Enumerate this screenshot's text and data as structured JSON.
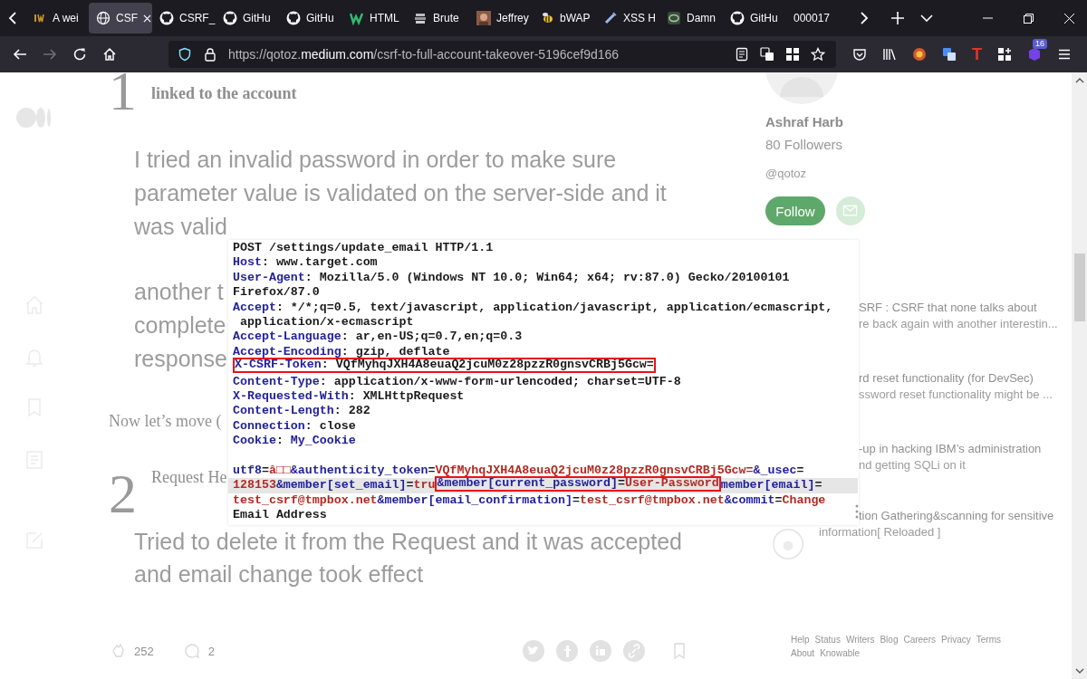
{
  "tabs": [
    {
      "label": "A wei",
      "kind": "letters",
      "selected": false
    },
    {
      "label": "CSF",
      "kind": "globe",
      "selected": true
    },
    {
      "label": "CSRF_",
      "kind": "github",
      "selected": false
    },
    {
      "label": "GitHu",
      "kind": "github",
      "selected": false
    },
    {
      "label": "GitHu",
      "kind": "github",
      "selected": false
    },
    {
      "label": "HTML",
      "kind": "w",
      "selected": false
    },
    {
      "label": "Brute",
      "kind": "stack",
      "selected": false
    },
    {
      "label": "Jeffrey",
      "selected": false
    },
    {
      "label": "bWAP",
      "kind": "bee",
      "selected": false
    },
    {
      "label": "XSS H",
      "kind": "pen",
      "selected": false
    },
    {
      "label": "Damn",
      "kind": "ring",
      "selected": false
    },
    {
      "label": "GitHu",
      "kind": "github",
      "selected": false
    },
    {
      "label": "000017",
      "kind": "plain",
      "selected": false
    }
  ],
  "navigation": {
    "forward_disabled": true
  },
  "address_bar": {
    "scheme": "https://qotoz.",
    "domain": "medium.com",
    "path": "/csrf-to-full-account-takeover-5196cef9d166"
  },
  "extensions": {
    "letter": "T",
    "badge": "16"
  },
  "article": {
    "step_one": {
      "number": "1",
      "heading": "linked to the account"
    },
    "paragraph_one": [
      "I tried an invalid password in order to make sure",
      "parameter value is validated on the server-side and it",
      "was valid"
    ],
    "paragraph_two": [
      "another t",
      "complete",
      "response"
    ],
    "transition": "Now let’s move (",
    "step_two": {
      "number": "2",
      "heading": "Request He"
    },
    "paragraph_three": [
      "Tried to delete it from the Request and it was accepted",
      "and email change took effect"
    ]
  },
  "engagement": {
    "claps": "252",
    "responses": "2"
  },
  "author": {
    "name": "Ashraf Harb",
    "followers": "80 Followers",
    "handle": "@qotoz",
    "follow": "Follow"
  },
  "related": [
    {
      "title": "SRF : CSRF that none talks about",
      "subtitle": "re back again with another interestin...",
      "kind": "plain"
    },
    {
      "title": "rd reset functionality (for DevSec)",
      "subtitle": "ssword reset functionality might be ...",
      "kind": "plain"
    },
    {
      "title": "-up in hacking IBM’s administration",
      "subtitle": "nd getting SQLi on it",
      "kind": "plain"
    },
    {
      "title": "tion Gathering&scanning for sensitive",
      "subtitle": "information[ Reloaded ]",
      "kind": "badge"
    }
  ],
  "footer": [
    "Help",
    "Status",
    "Writers",
    "Blog",
    "Careers",
    "Privacy",
    "Terms",
    "About",
    "Knowable"
  ],
  "code_image": {
    "lines": [
      {
        "kind": "text",
        "highlighted": false,
        "shaded": false,
        "segments": [
          {
            "kind": "text",
            "text": "POST /settings/update_email HTTP/1.1"
          }
        ]
      },
      {
        "kind": "text",
        "highlighted": false,
        "shaded": false,
        "segments": [
          {
            "kind": "name",
            "text": "Host"
          },
          {
            "kind": "text",
            "text": ": www.target.com"
          }
        ]
      },
      {
        "kind": "text",
        "highlighted": false,
        "shaded": false,
        "segments": [
          {
            "kind": "name",
            "text": "User-Agent"
          },
          {
            "kind": "text",
            "text": ": Mozilla/5.0 (Windows NT 10.0; Win64; x64; rv:87.0) Gecko/20100101"
          }
        ]
      },
      {
        "kind": "text",
        "highlighted": false,
        "shaded": false,
        "segments": [
          {
            "kind": "text",
            "text": "Firefox/87.0"
          }
        ]
      },
      {
        "kind": "text",
        "highlighted": false,
        "shaded": false,
        "segments": [
          {
            "kind": "name",
            "text": "Accept"
          },
          {
            "kind": "text",
            "text": ": */*;q=0.5, text/javascript, application/javascript, application/ecmascript,"
          }
        ]
      },
      {
        "kind": "text",
        "highlighted": false,
        "shaded": false,
        "segments": [
          {
            "kind": "text",
            "text": " application/x-ecmascript"
          }
        ]
      },
      {
        "kind": "text",
        "highlighted": false,
        "shaded": false,
        "segments": [
          {
            "kind": "name",
            "text": "Accept-Language"
          },
          {
            "kind": "text",
            "text": ": ar,en-US;q=0.7,en;q=0.3"
          }
        ]
      },
      {
        "kind": "text",
        "highlighted": false,
        "shaded": false,
        "segments": [
          {
            "kind": "name",
            "text": "Accept-Encoding"
          },
          {
            "kind": "text",
            "text": ": gzip, deflate"
          }
        ]
      },
      {
        "kind": "text",
        "highlighted": true,
        "shaded": false,
        "segments": [
          {
            "kind": "name",
            "text": "X-CSRF-Token"
          },
          {
            "kind": "text",
            "text": ": VQfMyhqJXH4A8euaQ2jcuM0z28pzzR0gnsvCRBj5Gcw="
          }
        ]
      },
      {
        "kind": "text",
        "highlighted": false,
        "shaded": false,
        "segments": [
          {
            "kind": "name",
            "text": "Content-Type"
          },
          {
            "kind": "text",
            "text": ": application/x-www-form-urlencoded; charset=UTF-8"
          }
        ]
      },
      {
        "kind": "text",
        "highlighted": false,
        "shaded": false,
        "segments": [
          {
            "kind": "name",
            "text": "X-Requested-With"
          },
          {
            "kind": "text",
            "text": ": XMLHttpRequest"
          }
        ]
      },
      {
        "kind": "text",
        "highlighted": false,
        "shaded": false,
        "segments": [
          {
            "kind": "name",
            "text": "Content-Length"
          },
          {
            "kind": "text",
            "text": ": 282"
          }
        ]
      },
      {
        "kind": "text",
        "highlighted": false,
        "shaded": false,
        "segments": [
          {
            "kind": "name",
            "text": "Connection"
          },
          {
            "kind": "text",
            "text": ": close"
          }
        ]
      },
      {
        "kind": "text",
        "highlighted": false,
        "shaded": false,
        "segments": [
          {
            "kind": "name",
            "text": "Cookie"
          },
          {
            "kind": "text",
            "text": ": "
          },
          {
            "kind": "name",
            "text": "My_Cookie"
          }
        ]
      },
      {
        "kind": "blank"
      },
      {
        "kind": "text",
        "highlighted": false,
        "shaded": false,
        "segments": [
          {
            "kind": "name",
            "text": "utf8"
          },
          {
            "kind": "text",
            "text": "="
          },
          {
            "kind": "value",
            "text": "â□□"
          },
          {
            "kind": "name",
            "text": "&authenticity_token"
          },
          {
            "kind": "text",
            "text": "="
          },
          {
            "kind": "value",
            "text": "VQfMyhqJXH4A8euaQ2jcuM0z28pzzR0gnsvCRBj5Gcw="
          },
          {
            "kind": "name",
            "text": "&_usec"
          },
          {
            "kind": "text",
            "text": "="
          }
        ]
      },
      {
        "kind": "text",
        "highlighted": false,
        "shaded": true,
        "segments": [
          {
            "kind": "value",
            "text": "128153"
          },
          {
            "kind": "name",
            "text": "&member[set_email]"
          },
          {
            "kind": "text",
            "text": "="
          },
          {
            "kind": "value",
            "text": "tru"
          },
          {
            "kind": "box",
            "segments": [
              {
                "kind": "name",
                "text": "&member[current_password]"
              },
              {
                "kind": "text",
                "text": "="
              },
              {
                "kind": "value",
                "text": "User-Password"
              }
            ]
          },
          {
            "kind": "name",
            "text": "member[email]"
          },
          {
            "kind": "text",
            "text": "="
          }
        ]
      },
      {
        "kind": "text",
        "highlighted": false,
        "shaded": false,
        "segments": [
          {
            "kind": "value",
            "text": "test_csrf@tmpbox.net"
          },
          {
            "kind": "name",
            "text": "&member[email_confirmation]"
          },
          {
            "kind": "text",
            "text": "="
          },
          {
            "kind": "value",
            "text": "test_csrf@tmpbox.net"
          },
          {
            "kind": "name",
            "text": "&commit"
          },
          {
            "kind": "text",
            "text": "="
          },
          {
            "kind": "value",
            "text": "Change"
          }
        ]
      },
      {
        "kind": "text",
        "highlighted": false,
        "shaded": false,
        "segments": [
          {
            "kind": "text",
            "text": "Email Address"
          }
        ]
      }
    ]
  }
}
